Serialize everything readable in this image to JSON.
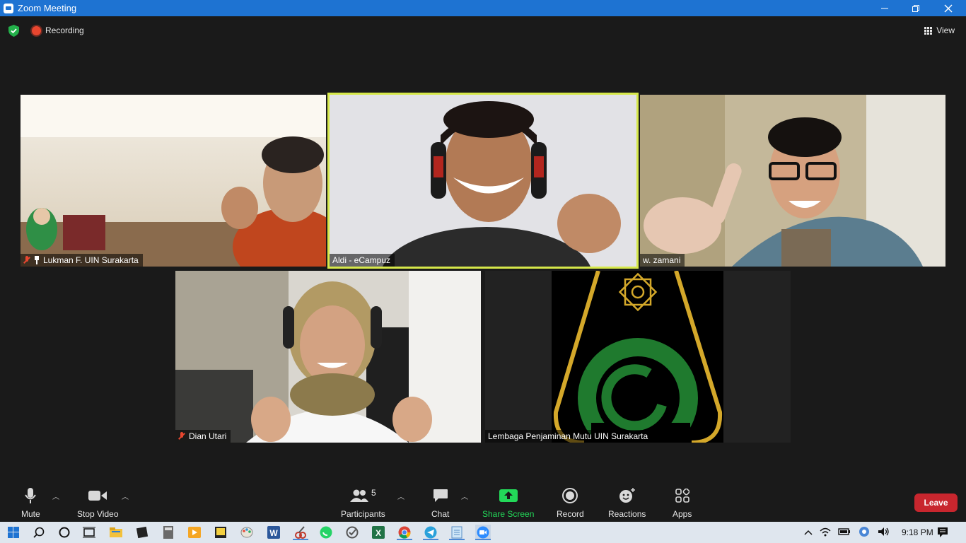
{
  "window": {
    "title": "Zoom Meeting"
  },
  "topbar": {
    "recording_label": "Recording",
    "view_label": "View"
  },
  "participants_tiles": [
    {
      "name": "Lukman F. UIN Surakarta",
      "muted": true,
      "pinned": true
    },
    {
      "name": "Aldi - eCampuz",
      "muted": false,
      "active_speaker": true
    },
    {
      "name": "w. zamani",
      "muted": false
    },
    {
      "name": "Dian Utari",
      "muted": true
    },
    {
      "name": "Lembaga Penjaminan Mutu UIN Surakarta",
      "muted": false
    }
  ],
  "toolbar": {
    "mute_label": "Mute",
    "stop_video_label": "Stop Video",
    "participants_label": "Participants",
    "participants_count": "5",
    "chat_label": "Chat",
    "share_screen_label": "Share Screen",
    "record_label": "Record",
    "reactions_label": "Reactions",
    "apps_label": "Apps",
    "leave_label": "Leave"
  },
  "taskbar": {
    "clock": "9:18 PM"
  },
  "colors": {
    "title_bar": "#1e73d2",
    "active_speaker": "#d6e84a",
    "share_screen": "#23d959",
    "leave": "#c8262e",
    "logo_gold": "#d4a82a",
    "logo_green": "#1f7a2e"
  }
}
